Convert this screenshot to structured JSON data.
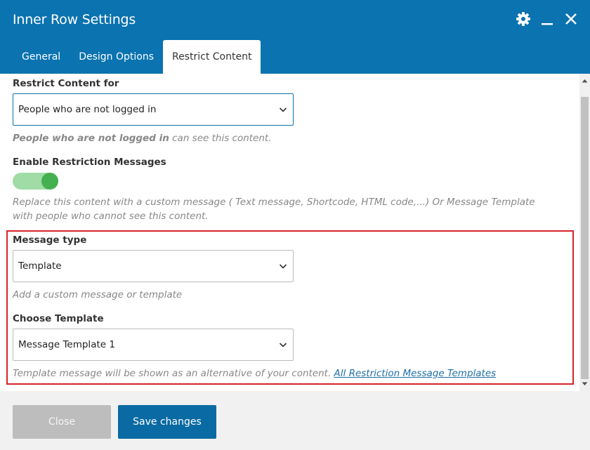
{
  "dialog": {
    "title": "Inner Row Settings"
  },
  "header_icons": [
    "gear-icon",
    "minimize-icon",
    "close-icon"
  ],
  "tabs": [
    {
      "label": "General",
      "active": false
    },
    {
      "label": "Design Options",
      "active": false
    },
    {
      "label": "Restrict Content",
      "active": true
    }
  ],
  "restrict": {
    "label": "Restrict Content for",
    "selected": "People who are not logged in",
    "help_bold": "People who are not logged in",
    "help_rest": " can see this content."
  },
  "restriction_messages": {
    "label": "Enable Restriction Messages",
    "enabled": true,
    "help": "Replace this content with a custom message ( Text message, Shortcode, HTML code,...) Or Message Template with people who cannot see this content."
  },
  "message_type": {
    "label": "Message type",
    "selected": "Template",
    "help": "Add a custom message or template"
  },
  "choose_template": {
    "label": "Choose Template",
    "selected": "Message Template 1",
    "help": "Template message will be shown as an alternative of your content. ",
    "link": "All Restriction Message Templates"
  },
  "footer": {
    "close_label": "Close",
    "save_label": "Save changes"
  },
  "colors": {
    "header": "#0a73b0",
    "toggle_track": "#9fdca6",
    "toggle_knob": "#45b04f",
    "highlight_border": "#d8232a",
    "save_button": "#0a6aa3",
    "close_button": "#bdbdbd"
  }
}
